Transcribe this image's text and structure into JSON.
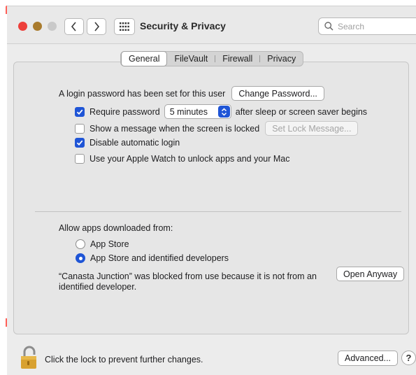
{
  "window": {
    "title": "Security & Privacy",
    "search_placeholder": "Search"
  },
  "tabs": [
    {
      "label": "General",
      "active": true
    },
    {
      "label": "FileVault",
      "active": false
    },
    {
      "label": "Firewall",
      "active": false
    },
    {
      "label": "Privacy",
      "active": false
    }
  ],
  "general": {
    "login_text": "A login password has been set for this user",
    "change_password_label": "Change Password...",
    "require_password": {
      "label": "Require password",
      "checked": true,
      "select_value": "5 minutes",
      "suffix": "after sleep or screen saver begins"
    },
    "show_message": {
      "label": "Show a message when the screen is locked",
      "checked": false,
      "button_label": "Set Lock Message..."
    },
    "disable_auto_login": {
      "label": "Disable automatic login",
      "checked": true
    },
    "apple_watch": {
      "label": "Use your Apple Watch to unlock apps and your Mac",
      "checked": false
    }
  },
  "downloads": {
    "heading": "Allow apps downloaded from:",
    "options": [
      {
        "label": "App Store",
        "selected": false
      },
      {
        "label": "App Store and identified developers",
        "selected": true
      }
    ],
    "blocked_message": "“Canasta Junction” was blocked from use because it is not from an identified developer.",
    "open_anyway_label": "Open Anyway"
  },
  "footer": {
    "lock_text": "Click the lock to prevent further changes.",
    "advanced_label": "Advanced...",
    "help_label": "?"
  },
  "colors": {
    "accent": "#1f55d6",
    "close": "#ed3f3a",
    "minimize": "#a97b2d",
    "zoom_disabled": "#c9c9c9"
  }
}
